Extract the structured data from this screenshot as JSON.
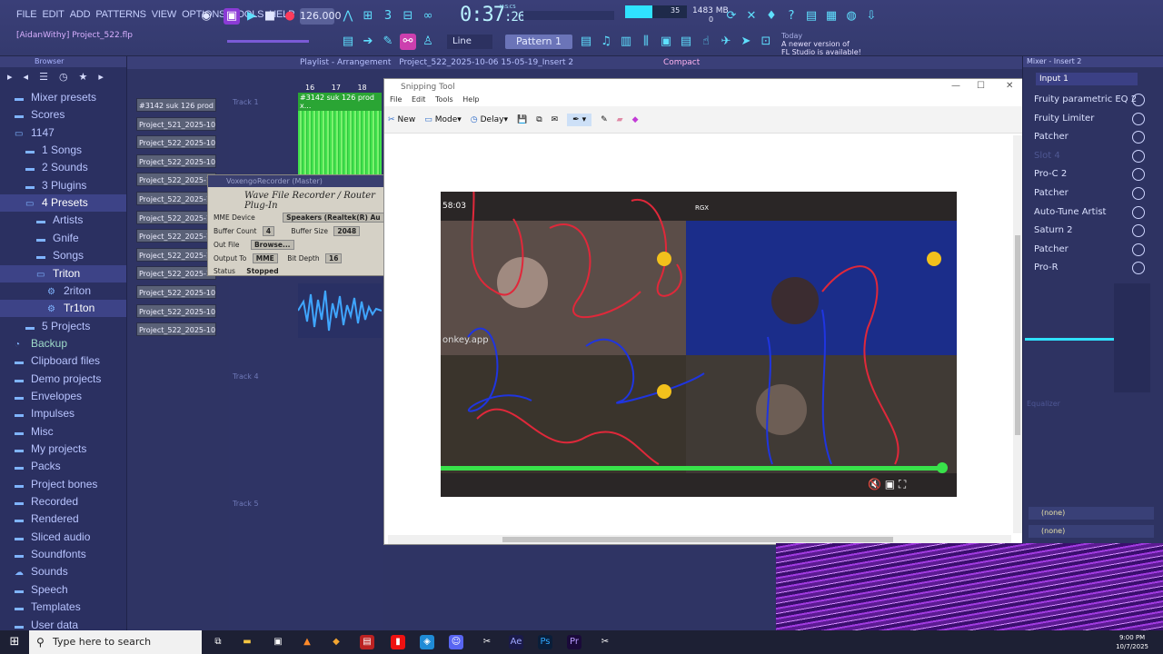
{
  "menu": [
    "FILE",
    "EDIT",
    "ADD",
    "PATTERNS",
    "VIEW",
    "OPTIONS",
    "TOOLS",
    "HELP"
  ],
  "transport": {
    "tempo": "126.000",
    "time_main": "0:37",
    "time_sub": "26",
    "time_label": "M:S:CS"
  },
  "monitor": {
    "cpu_label": "35",
    "mem": "1483 MB",
    "poly": "0"
  },
  "project_label": "[AidanWithy] Project_522.flp",
  "toolbar2": {
    "line": "Line",
    "pattern": "Pattern 1"
  },
  "news": {
    "day": "Today",
    "line1": "A newer version of",
    "line2": "FL Studio is available!"
  },
  "playlist": {
    "title": "Playlist - Arrangement",
    "project": "Project_522_2025-10-06 15-05-19_Insert 2",
    "compact": "Compact"
  },
  "browser": {
    "title": "Browser",
    "items": [
      {
        "label": "Mixer presets",
        "icon": "folder-icon",
        "indent": 0
      },
      {
        "label": "Scores",
        "icon": "folder-icon",
        "indent": 0
      },
      {
        "label": "1147",
        "icon": "folder-open-icon",
        "indent": 0
      },
      {
        "label": "1 Songs",
        "icon": "folder-icon",
        "indent": 1
      },
      {
        "label": "2 Sounds",
        "icon": "folder-icon",
        "indent": 1
      },
      {
        "label": "3 Plugins",
        "icon": "folder-icon",
        "indent": 1
      },
      {
        "label": "4 Presets",
        "icon": "folder-open-icon",
        "indent": 1,
        "active": true
      },
      {
        "label": "Artists",
        "icon": "folder-icon",
        "indent": 2
      },
      {
        "label": "Gnife",
        "icon": "folder-icon",
        "indent": 2
      },
      {
        "label": "Songs",
        "icon": "folder-icon",
        "indent": 2
      },
      {
        "label": "Triton",
        "icon": "folder-open-icon",
        "indent": 2,
        "active": true
      },
      {
        "label": "2riton",
        "icon": "gear-icon",
        "indent": 3
      },
      {
        "label": "Tr1ton",
        "icon": "gear-icon",
        "indent": 3,
        "active": true
      },
      {
        "label": "5 Projects",
        "icon": "folder-icon",
        "indent": 1
      },
      {
        "label": "Backup",
        "icon": "backup-icon",
        "indent": 0,
        "dim": true
      },
      {
        "label": "Clipboard files",
        "icon": "folder-icon",
        "indent": 0
      },
      {
        "label": "Demo projects",
        "icon": "folder-icon",
        "indent": 0
      },
      {
        "label": "Envelopes",
        "icon": "folder-icon",
        "indent": 0
      },
      {
        "label": "Impulses",
        "icon": "folder-icon",
        "indent": 0
      },
      {
        "label": "Misc",
        "icon": "folder-icon",
        "indent": 0
      },
      {
        "label": "My projects",
        "icon": "folder-icon",
        "indent": 0
      },
      {
        "label": "Packs",
        "icon": "folder-icon",
        "indent": 0
      },
      {
        "label": "Project bones",
        "icon": "folder-icon",
        "indent": 0
      },
      {
        "label": "Recorded",
        "icon": "folder-icon",
        "indent": 0
      },
      {
        "label": "Rendered",
        "icon": "folder-icon",
        "indent": 0
      },
      {
        "label": "Sliced audio",
        "icon": "folder-icon",
        "indent": 0
      },
      {
        "label": "Soundfonts",
        "icon": "folder-icon",
        "indent": 0
      },
      {
        "label": "Sounds",
        "icon": "cloud-icon",
        "indent": 0
      },
      {
        "label": "Speech",
        "icon": "folder-icon",
        "indent": 0
      },
      {
        "label": "Templates",
        "icon": "folder-icon",
        "indent": 0
      },
      {
        "label": "User data",
        "icon": "folder-icon",
        "indent": 0
      }
    ]
  },
  "clips": [
    "#3142 suk 126 prod x...",
    "Project_521_2025-10-06...",
    "Project_522_2025-10-06...",
    "Project_522_2025-10-06...",
    "Project_522_2025-10",
    "Project_522_2025-10",
    "Project_522_2025-10",
    "Project_522_2025-10",
    "Project_522_2025-10",
    "Project_522_2025-10",
    "Project_522_2025-10-06...",
    "Project_522_2025-10-06...",
    "Project_522_2025-10-06..."
  ],
  "tracks": {
    "t1": "Track 1",
    "t4": "Track 4",
    "t5": "Track 5",
    "ruler1": "16",
    "ruler2": "17",
    "ruler3": "18",
    "green_cap": "#3142 suk 126 prod x..."
  },
  "recorder": {
    "title": "VoxengoRecorder (Master)",
    "heading": "Wave File Recorder / Router Plug-In",
    "mme_label": "MME Device",
    "mme_value": "Speakers (Realtek(R) Au",
    "buf_count_label": "Buffer Count",
    "buf_count": "4",
    "buf_size_label": "Buffer Size",
    "buf_size": "2048",
    "out_file_label": "Out File",
    "browse": "Browse...",
    "output_to_label": "Output To",
    "output_to": "MME",
    "bit_depth_label": "Bit Depth",
    "bit_depth": "16",
    "status_label": "Status",
    "status": "Stopped"
  },
  "snip": {
    "title": "Snipping Tool",
    "menu": [
      "File",
      "Edit",
      "Tools",
      "Help"
    ],
    "new": "New",
    "mode": "Mode",
    "delay": "Delay",
    "video_time": "58:03",
    "watermark": "onkey.app",
    "rgx": "RGX"
  },
  "mixer": {
    "title": "Mixer - Insert 2",
    "input": "Input 1",
    "slots": [
      {
        "label": "Fruity parametric EQ 2"
      },
      {
        "label": "Fruity Limiter"
      },
      {
        "label": "Patcher"
      },
      {
        "label": "Slot 4",
        "dim": true
      },
      {
        "label": "Pro-C 2"
      },
      {
        "label": "Patcher"
      },
      {
        "label": "Auto-Tune Artist"
      },
      {
        "label": "Saturn 2"
      },
      {
        "label": "Patcher"
      },
      {
        "label": "Pro-R"
      }
    ],
    "equalizer": "Equalizer",
    "none1": "(none)",
    "none2": "(none)"
  },
  "taskbar": {
    "search": "Type here to search",
    "time": "9:00 PM",
    "date": "10/7/2025"
  },
  "colors": {
    "accent": "#5fe0ff",
    "green": "#41e14c",
    "panel": "#2b3061"
  }
}
